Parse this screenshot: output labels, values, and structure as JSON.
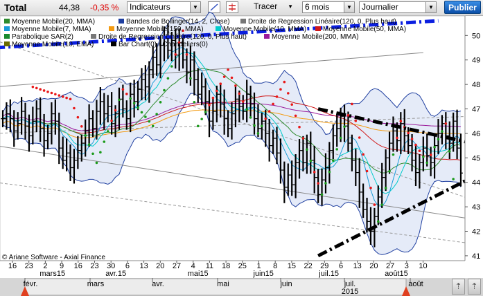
{
  "header": {
    "ticker": "Total",
    "last": "44,38",
    "change": "-0,35 %",
    "indicators_label": "Indicateurs",
    "tracer_label": "Tracer",
    "period_label": "6 mois",
    "interval_label": "Journalier",
    "publish_label": "Publier"
  },
  "legend": [
    {
      "label": "Moyenne Mobile(20, MMA)",
      "color": "#2e8b2e"
    },
    {
      "label": "Bandes de Bollinger(14, 2, Close)",
      "color": "#1f3fa0"
    },
    {
      "label": "Droite de Regression Linéaire(120, 0, Plus haut)",
      "color": "#777777"
    },
    {
      "label": "Moyenne Mobile(7, MMA)",
      "color": "#1a9cd8"
    },
    {
      "label": "Moyenne Mobile(150, MMA)",
      "color": "#f39b12"
    },
    {
      "label": "Moyenne Mobile(10, MMA)",
      "color": "#00cccc"
    },
    {
      "label": "Moyenne Mobile(50, MMA)",
      "color": "#d01818"
    },
    {
      "label": "Parabolique SAR(2)",
      "color": "#1a8a2e"
    },
    {
      "label": "Droite de Regression Linéaire(120, 0, Plus haut)",
      "color": "#777777"
    },
    {
      "label": "Moyenne Mobile(200, MMA)",
      "color": "#9a1a9a"
    },
    {
      "label": "Moyenne Mobile(10, EMA)",
      "color": "#6b6b00"
    },
    {
      "label": "Bar Chart(0) / Chandeliers(0)",
      "color": "#000000"
    }
  ],
  "copyright": "© Ariane Software - Axial Finance",
  "chart_data": {
    "type": "bar",
    "ylim": [
      40.8,
      50.8
    ],
    "y_ticks": [
      41,
      42,
      43,
      44,
      45,
      46,
      47,
      48,
      49,
      50
    ],
    "x_day_labels": [
      "16",
      "23",
      "2",
      "9",
      "16",
      "23",
      "30",
      "6",
      "13",
      "20",
      "27",
      "4",
      "11",
      "18",
      "25",
      "1",
      "8",
      "15",
      "22",
      "29",
      "6",
      "13",
      "20",
      "27",
      "3",
      "10"
    ],
    "x_month_labels": [
      "mars15",
      "avr.15",
      "mai15",
      "juin15",
      "juil.15",
      "août15"
    ],
    "navigator_labels": [
      "févr.",
      "mars",
      "avr.",
      "mai",
      "juin",
      "juil.",
      "août"
    ],
    "navigator_year": "2015",
    "closes": [
      46.6,
      46.8,
      46.6,
      46.1,
      46.4,
      46.9,
      46.3,
      45.9,
      46.5,
      47.0,
      46.2,
      45.7,
      46.0,
      46.8,
      46.5,
      45.4,
      44.9,
      45.2,
      44.6,
      44.9,
      45.3,
      45.6,
      46.1,
      46.6,
      46.2,
      46.9,
      47.3,
      46.8,
      47.1,
      46.4,
      46.8,
      47.4,
      47.0,
      46.6,
      47.6,
      47.3,
      47.8,
      48.2,
      47.9,
      48.6,
      49.1,
      48.8,
      49.6,
      49.9,
      49.4,
      49.8,
      49.2,
      49.7,
      49.0,
      48.5,
      49.0,
      48.2,
      47.6,
      47.9,
      47.3,
      46.5,
      46.9,
      47.6,
      47.2,
      46.6,
      46.2,
      46.8,
      47.4,
      47.1,
      46.9,
      47.6,
      47.2,
      46.6,
      46.2,
      46.5,
      46.0,
      45.5,
      45.8,
      45.2,
      44.5,
      43.8,
      44.3,
      43.9,
      44.8,
      45.3,
      44.8,
      45.6,
      44.9,
      44.2,
      43.5,
      44.1,
      44.6,
      45.3,
      45.9,
      46.2,
      46.7,
      46.3,
      45.6,
      44.9,
      44.4,
      43.6,
      42.9,
      42.4,
      42.0,
      42.6,
      43.4,
      44.2,
      45.0,
      45.6,
      46.1,
      45.7,
      46.4,
      45.9,
      45.5,
      44.9,
      44.4,
      44.8,
      45.4,
      45.1,
      44.8,
      45.5,
      46.0,
      46.4,
      45.9,
      45.6,
      46.5,
      45.4,
      44.38
    ],
    "sar_points": [
      [
        8,
        47.9
      ],
      [
        18,
        47.4
      ],
      [
        25,
        44.8
      ],
      [
        32,
        47.8
      ],
      [
        40,
        46.3
      ],
      [
        48,
        50.2
      ],
      [
        52,
        46.3
      ],
      [
        60,
        48.6
      ],
      [
        68,
        46.0
      ],
      [
        75,
        48.1
      ],
      [
        85,
        43.5
      ],
      [
        93,
        47.2
      ],
      [
        100,
        42.4
      ],
      [
        106,
        46.5
      ],
      [
        113,
        44.8
      ],
      [
        118,
        46.4
      ],
      [
        121,
        43.0
      ]
    ],
    "trendlines": [
      {
        "name": "resistance-upper",
        "color": "#0b1fe0",
        "from": [
          -2,
          49.5
        ],
        "to": [
          116,
          50.6
        ]
      },
      {
        "name": "channel-top",
        "color": "#000000",
        "from": [
          84,
          47.0
        ],
        "to": [
          125,
          45.6
        ]
      },
      {
        "name": "channel-bottom",
        "color": "#000000",
        "from": [
          84,
          41.0
        ],
        "to": [
          125,
          44.2
        ]
      }
    ]
  }
}
